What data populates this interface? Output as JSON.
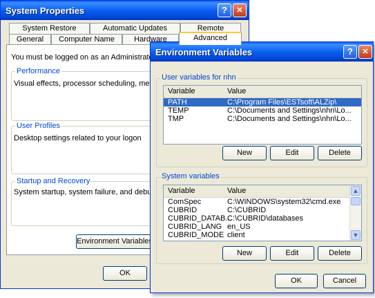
{
  "sysprops": {
    "title": "System Properties",
    "tabs_row1": [
      "System Restore",
      "Automatic Updates",
      "Remote"
    ],
    "tabs_row2": [
      "General",
      "Computer Name",
      "Hardware",
      "Advanced"
    ],
    "admin_note": "You must be logged on as an Administrator to m",
    "performance": {
      "label": "Performance",
      "desc": "Visual effects, processor scheduling, memory u"
    },
    "user_profiles": {
      "label": "User Profiles",
      "desc": "Desktop settings related to your logon"
    },
    "startup": {
      "label": "Startup and Recovery",
      "desc": "System startup, system failure, and debugging"
    },
    "env_button": "Environment Variables",
    "ok": "OK"
  },
  "envvars": {
    "title": "Environment Variables",
    "user_section": "User variables for nhn",
    "columns": {
      "variable": "Variable",
      "value": "Value"
    },
    "user_vars": [
      {
        "name": "PATH",
        "value": "C:\\Program Files\\ESTsoft\\ALZip\\",
        "selected": true
      },
      {
        "name": "TEMP",
        "value": "C:\\Documents and Settings\\nhn\\Lo...",
        "selected": false
      },
      {
        "name": "TMP",
        "value": "C:\\Documents and Settings\\nhn\\Lo...",
        "selected": false
      }
    ],
    "user_buttons": {
      "new": "New",
      "edit": "Edit",
      "delete": "Delete"
    },
    "system_section": "System variables",
    "system_vars": [
      {
        "name": "ComSpec",
        "value": "C:\\WINDOWS\\system32\\cmd.exe"
      },
      {
        "name": "CUBRID",
        "value": "C:\\CUBRID"
      },
      {
        "name": "CUBRID_DATAB...",
        "value": "C:\\CUBRID\\databases"
      },
      {
        "name": "CUBRID_LANG",
        "value": "en_US"
      },
      {
        "name": "CUBRID_MODE",
        "value": "client"
      }
    ],
    "system_buttons": {
      "new": "New",
      "edit": "Edit",
      "delete": "Delete"
    },
    "ok": "OK",
    "cancel": "Cancel"
  },
  "icons": {
    "help": "?",
    "close": "✕",
    "scroll_up": "▲",
    "scroll_down": "▼"
  },
  "colors": {
    "title_blue": "#0a5ff0",
    "selection": "#316ac5",
    "group_label": "#0046d5"
  }
}
